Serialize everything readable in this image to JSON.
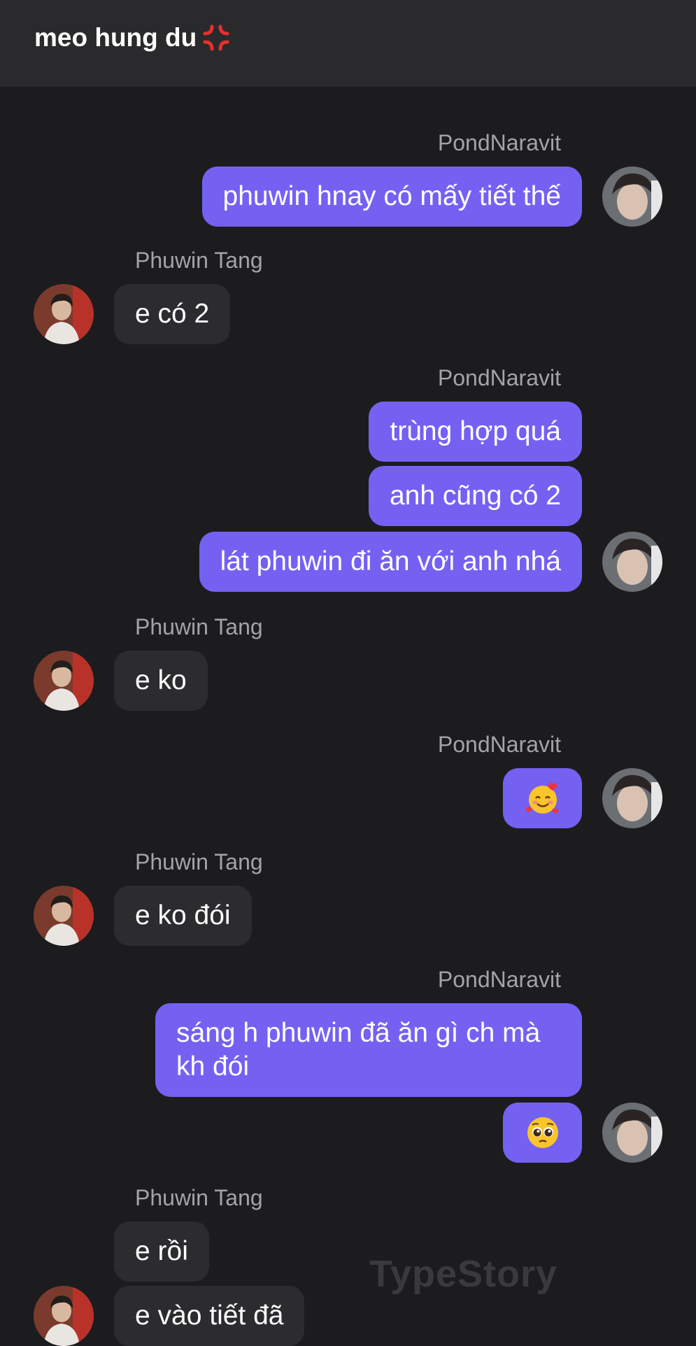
{
  "header": {
    "title": "meo hung du",
    "title_icon": "anger-symbol-icon"
  },
  "participants": {
    "me": "PondNaravit",
    "other": "Phuwin Tang"
  },
  "messages": [
    {
      "sender": "PondNaravit",
      "text": "phuwin hnay có mấy tiết thế"
    },
    {
      "sender": "Phuwin Tang",
      "text": "e có 2"
    },
    {
      "sender": "PondNaravit",
      "text": "trùng hợp quá"
    },
    {
      "sender": "PondNaravit",
      "text": "anh cũng có 2"
    },
    {
      "sender": "PondNaravit",
      "text": "lát phuwin đi ăn với anh nhá"
    },
    {
      "sender": "Phuwin Tang",
      "text": "e ko"
    },
    {
      "sender": "PondNaravit",
      "emoji": "smiling-face-with-hearts"
    },
    {
      "sender": "Phuwin Tang",
      "text": "e ko đói"
    },
    {
      "sender": "PondNaravit",
      "text": "sáng h phuwin đã ăn gì ch mà kh đói"
    },
    {
      "sender": "PondNaravit",
      "emoji": "pleading-face"
    },
    {
      "sender": "Phuwin Tang",
      "text": "e rồi"
    },
    {
      "sender": "Phuwin Tang",
      "text": "e vào tiết đã"
    }
  ],
  "watermark": "TypeStory",
  "colors": {
    "background": "#1c1c1e",
    "header": "#2a2a2c",
    "outgoing_bubble": "#7461f2",
    "incoming_bubble": "#2c2c2f",
    "name_text": "#a3a3a8"
  }
}
